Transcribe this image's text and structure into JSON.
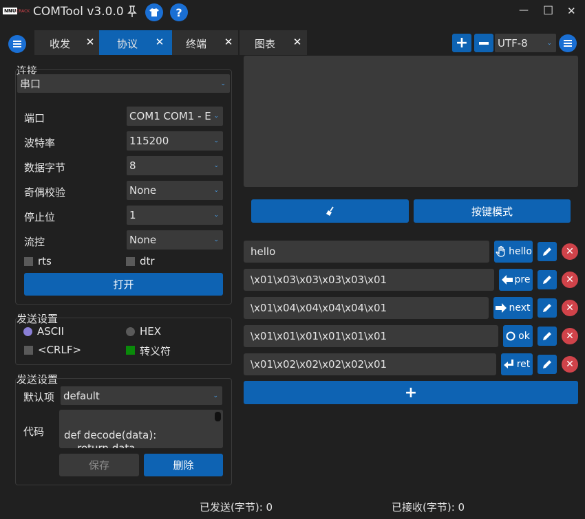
{
  "app": {
    "logo_top": "NNU",
    "logo_bottom": "CRACK",
    "title": "COMTool v3.0.0"
  },
  "window_controls": {
    "minimize": "—",
    "maximize": "☐",
    "close": "✕"
  },
  "tabs": [
    {
      "label": "收发",
      "active": false
    },
    {
      "label": "协议",
      "active": true
    },
    {
      "label": "终端",
      "active": false
    },
    {
      "label": "图表",
      "active": false
    }
  ],
  "toolbar": {
    "encoding": "UTF-8"
  },
  "connection": {
    "group_title": "连接",
    "type": "串口",
    "fields": [
      {
        "label": "端口",
        "value": "COM1 COM1 - E"
      },
      {
        "label": "波特率",
        "value": "115200"
      },
      {
        "label": "数据字节",
        "value": "8"
      },
      {
        "label": "奇偶校验",
        "value": "None"
      },
      {
        "label": "停止位",
        "value": "1"
      },
      {
        "label": "流控",
        "value": "None"
      }
    ],
    "rts_label": "rts",
    "dtr_label": "dtr",
    "open_label": "打开"
  },
  "send_settings": {
    "group_title": "发送设置",
    "ascii_label": "ASCII",
    "hex_label": "HEX",
    "crlf_label": "<CRLF>",
    "escape_label": "转义符"
  },
  "decode_settings": {
    "group_title": "发送设置",
    "default_label": "默认项",
    "default_value": "default",
    "code_label": "代码",
    "code_line1": "def decode(data):",
    "code_line2": "    return data",
    "save_label": "保存",
    "delete_label": "删除"
  },
  "main": {
    "key_mode_label": "按键模式",
    "shortcuts": [
      {
        "text": "hello",
        "button": "hello",
        "icon": "hand-icon"
      },
      {
        "text": "\\x01\\x03\\x03\\x03\\x03\\x01",
        "button": "pre",
        "icon": "arrow-left-icon"
      },
      {
        "text": "\\x01\\x04\\x04\\x04\\x04\\x01",
        "button": "next",
        "icon": "arrow-right-icon"
      },
      {
        "text": "\\x01\\x01\\x01\\x01\\x01\\x01",
        "button": "ok",
        "icon": "circle-icon"
      },
      {
        "text": "\\x01\\x02\\x02\\x02\\x02\\x01",
        "button": "ret",
        "icon": "return-icon"
      }
    ],
    "add_label": "+"
  },
  "status": {
    "sent": "已发送(字节): 0",
    "received": "已接收(字节): 0"
  },
  "colors": {
    "accent": "#0e63b3",
    "background": "#202020",
    "panel": "#3a3a3a",
    "danger": "#d0434a",
    "radio_on": "#8a7fd6",
    "escape_check": "#0a8a0a"
  }
}
